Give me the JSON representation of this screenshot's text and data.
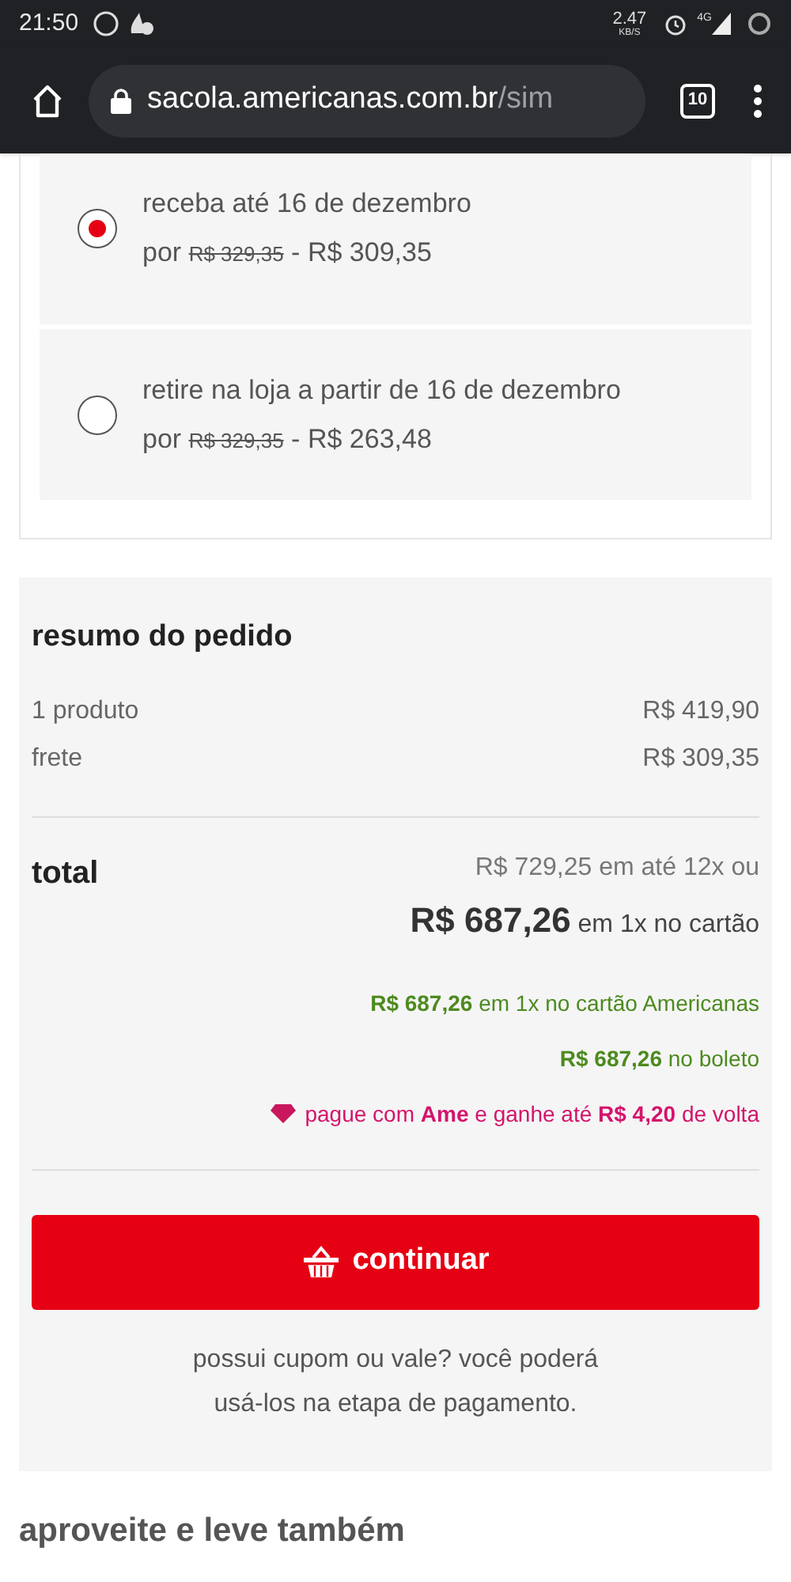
{
  "status_bar": {
    "time": "21:50",
    "speed": "2.47",
    "speed_unit": "KB/S",
    "network": "4G"
  },
  "browser": {
    "domain": "sacola.americanas.com.br",
    "path": "/sim",
    "tab_count": "10"
  },
  "delivery_options": [
    {
      "title": "receba até 16 de dezembro",
      "prefix": "por",
      "old_price": "R$ 329,35",
      "separator": "-",
      "price": "R$ 309,35",
      "selected": true
    },
    {
      "title": "retire na loja a partir de 16 de dezembro",
      "prefix": "por",
      "old_price": "R$ 329,35",
      "separator": "-",
      "price": "R$ 263,48",
      "selected": false
    }
  ],
  "summary": {
    "title": "resumo do pedido",
    "lines": [
      {
        "label": "1 produto",
        "value": "R$ 419,90"
      },
      {
        "label": "frete",
        "value": "R$ 309,35"
      }
    ],
    "total_label": "total",
    "installments": "R$ 729,25 em até 12x ou",
    "total_amount": "R$ 687,26",
    "total_suffix": "em 1x no cartão",
    "offers": [
      {
        "kind": "green",
        "text": "**R$ 687,26** em 1x no cartão Americanas"
      },
      {
        "kind": "green",
        "text": "**R$ 687,26** no boleto"
      },
      {
        "kind": "ame",
        "text": "pague com **Ame** e ganhe até **R$ 4,20** de volta"
      }
    ],
    "button": "continuar",
    "note_lines": [
      "possui cupom ou vale? você poderá",
      "usá-los na etapa de pagamento."
    ]
  },
  "section_title": "aproveite e leve também"
}
